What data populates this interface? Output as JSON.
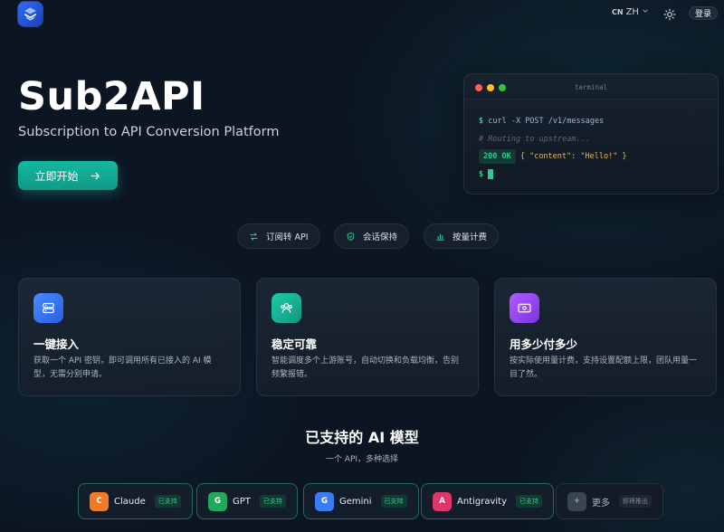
{
  "header": {
    "lang_code": "CN",
    "lang_label": "ZH",
    "login_label": "登录",
    "accent": "#2f6df6"
  },
  "hero": {
    "title": "Sub2API",
    "subtitle": "Subscription to API Conversion Platform",
    "cta_label": "立即开始"
  },
  "terminal": {
    "title": "terminal",
    "lines": [
      {
        "prompt": "$",
        "text": "curl -X POST /v1/messages"
      },
      {
        "text": "# Routing to upstream..."
      },
      {
        "status": "200 OK",
        "text": "{ \"content\": \"Hello!\" }"
      },
      {
        "prompt": "$"
      }
    ]
  },
  "pills": [
    {
      "label": "订阅转 API",
      "icon": "swap-icon"
    },
    {
      "label": "会话保持",
      "icon": "shield-icon"
    },
    {
      "label": "按量计费",
      "icon": "bar-chart-icon"
    }
  ],
  "cards": [
    {
      "title": "一键接入",
      "desc": "获取一个 API 密钥，即可调用所有已接入的 AI 模型，无需分别申请。",
      "icon": "server-icon",
      "color": "#3b7bf6"
    },
    {
      "title": "稳定可靠",
      "desc": "智能调度多个上游账号，自动切换和负载均衡，告别频繁报错。",
      "icon": "users-icon",
      "color": "#16b89c"
    },
    {
      "title": "用多少付多少",
      "desc": "按实际使用量计费，支持设置配额上限，团队用量一目了然。",
      "icon": "billing-icon",
      "color": "#9b4df0"
    }
  ],
  "models_section": {
    "title": "已支持的 AI 模型",
    "subtitle": "一个 API，多种选择"
  },
  "models": [
    {
      "letter": "C",
      "name": "Claude",
      "tag": "已支持",
      "color": "#f07a28"
    },
    {
      "letter": "G",
      "name": "GPT",
      "tag": "已支持",
      "color": "#22a85a"
    },
    {
      "letter": "G",
      "name": "Gemini",
      "tag": "已支持",
      "color": "#3b7bf6"
    },
    {
      "letter": "A",
      "name": "Antigravity",
      "tag": "已支持",
      "color": "#e0356a"
    },
    {
      "letter": "+",
      "name": "更多",
      "tag": "即将推出",
      "color": "#3a4552"
    }
  ]
}
